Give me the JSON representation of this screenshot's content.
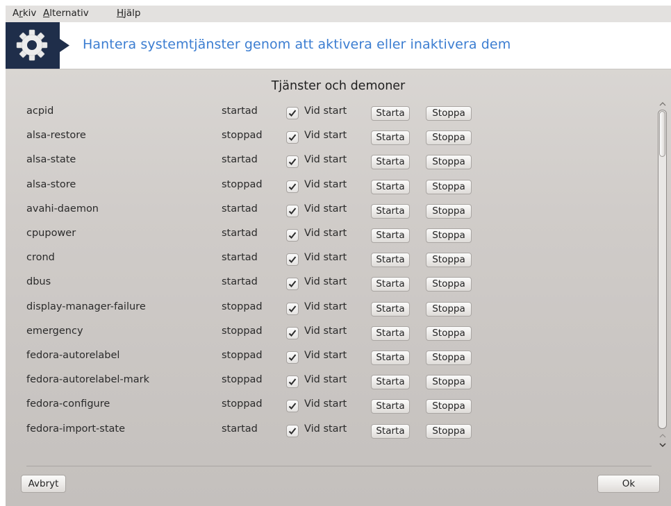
{
  "menubar": {
    "items": [
      {
        "pre": "A",
        "mn": "r",
        "post": "kiv"
      },
      {
        "pre": "",
        "mn": "A",
        "post": "lternativ"
      },
      {
        "pre": "",
        "mn": "H",
        "post": "jälp"
      }
    ]
  },
  "banner": {
    "icon": "gear-icon",
    "title": "Hantera systemtjänster genom att aktivera eller inaktivera dem",
    "title_color": "#3b7dd1",
    "icon_bg": "#1f2e4a"
  },
  "section_title": "Tjänster och demoner",
  "services": [
    {
      "name": "acpid",
      "status": "startad",
      "on_boot": true
    },
    {
      "name": "alsa-restore",
      "status": "stoppad",
      "on_boot": true
    },
    {
      "name": "alsa-state",
      "status": "startad",
      "on_boot": true
    },
    {
      "name": "alsa-store",
      "status": "stoppad",
      "on_boot": true
    },
    {
      "name": "avahi-daemon",
      "status": "startad",
      "on_boot": true
    },
    {
      "name": "cpupower",
      "status": "startad",
      "on_boot": true
    },
    {
      "name": "crond",
      "status": "startad",
      "on_boot": true
    },
    {
      "name": "dbus",
      "status": "startad",
      "on_boot": true
    },
    {
      "name": "display-manager-failure",
      "status": "stoppad",
      "on_boot": true
    },
    {
      "name": "emergency",
      "status": "stoppad",
      "on_boot": true
    },
    {
      "name": "fedora-autorelabel",
      "status": "stoppad",
      "on_boot": true
    },
    {
      "name": "fedora-autorelabel-mark",
      "status": "stoppad",
      "on_boot": true
    },
    {
      "name": "fedora-configure",
      "status": "stoppad",
      "on_boot": true
    },
    {
      "name": "fedora-import-state",
      "status": "startad",
      "on_boot": true
    }
  ],
  "row_labels": {
    "on_boot": "Vid start",
    "start": "Starta",
    "stop": "Stoppa"
  },
  "scrollbar": {
    "position_fraction": 0.0
  },
  "footer": {
    "cancel": "Avbryt",
    "ok": "Ok"
  }
}
